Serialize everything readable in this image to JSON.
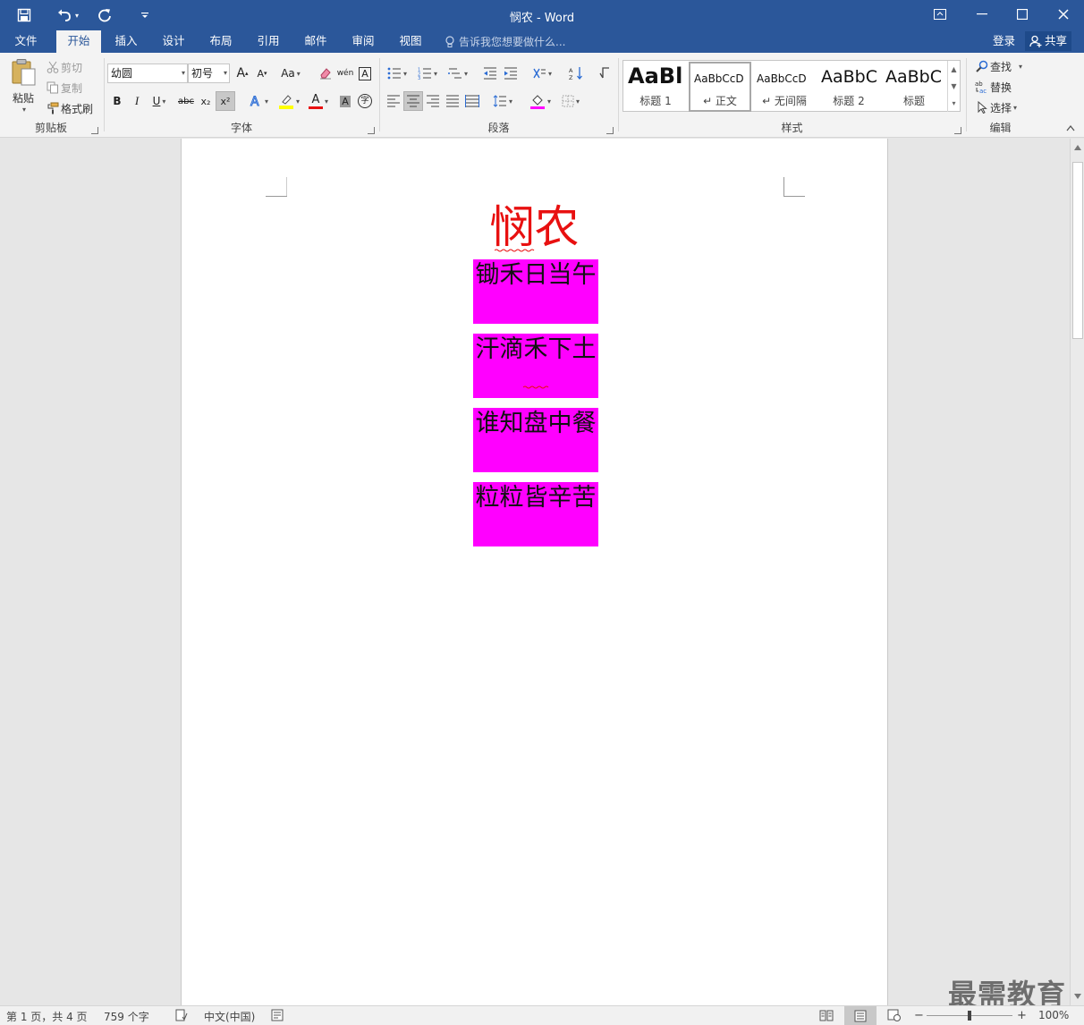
{
  "window": {
    "title": "悯农 - Word",
    "colors": {
      "accent": "#2b579a",
      "highlight": "#ff00ff",
      "title_red": "#e81010"
    }
  },
  "quick_access": {
    "icons": [
      "save-icon",
      "undo-icon",
      "redo-icon",
      "customize-icon"
    ]
  },
  "tabs": [
    "文件",
    "开始",
    "插入",
    "设计",
    "布局",
    "引用",
    "邮件",
    "审阅",
    "视图"
  ],
  "active_tab": "开始",
  "tell_me": "告诉我您想要做什么...",
  "account": {
    "login": "登录",
    "share": "共享"
  },
  "clipboard": {
    "label": "剪贴板",
    "paste": "粘贴",
    "cut": "剪切",
    "copy": "复制",
    "format_painter": "格式刷"
  },
  "font": {
    "label": "字体",
    "name": "幼圆",
    "size": "初号",
    "grow": "A",
    "shrink": "A",
    "case": "Aa",
    "bold": "B",
    "italic": "I",
    "underline": "U",
    "strike": "abc",
    "subscript": "x₂",
    "superscript": "x²",
    "phonetic": "wén",
    "border_char": "A",
    "font_color": "A",
    "shade": "A",
    "enclose": "字"
  },
  "paragraph": {
    "label": "段落"
  },
  "styles": {
    "label": "样式",
    "items": [
      {
        "sample": "AaBl",
        "name": "标题 1"
      },
      {
        "sample": "AaBbCcD",
        "name": "↵ 正文"
      },
      {
        "sample": "AaBbCcD",
        "name": "↵ 无间隔"
      },
      {
        "sample": "AaBbC",
        "name": "标题 2"
      },
      {
        "sample": "AaBbC",
        "name": "标题"
      }
    ]
  },
  "editing": {
    "label": "编辑",
    "find": "查找",
    "replace": "替换",
    "select": "选择"
  },
  "document": {
    "title": "悯农",
    "lines": [
      "锄禾日当午",
      "汗滴禾下土",
      "谁知盘中餐",
      "粒粒皆辛苦"
    ]
  },
  "status": {
    "page": "第 1 页，共 4 页",
    "words": "759 个字",
    "language": "中文(中国)",
    "zoom": "100%",
    "zoom_fraction": 0.5
  },
  "watermark": "最需教育"
}
